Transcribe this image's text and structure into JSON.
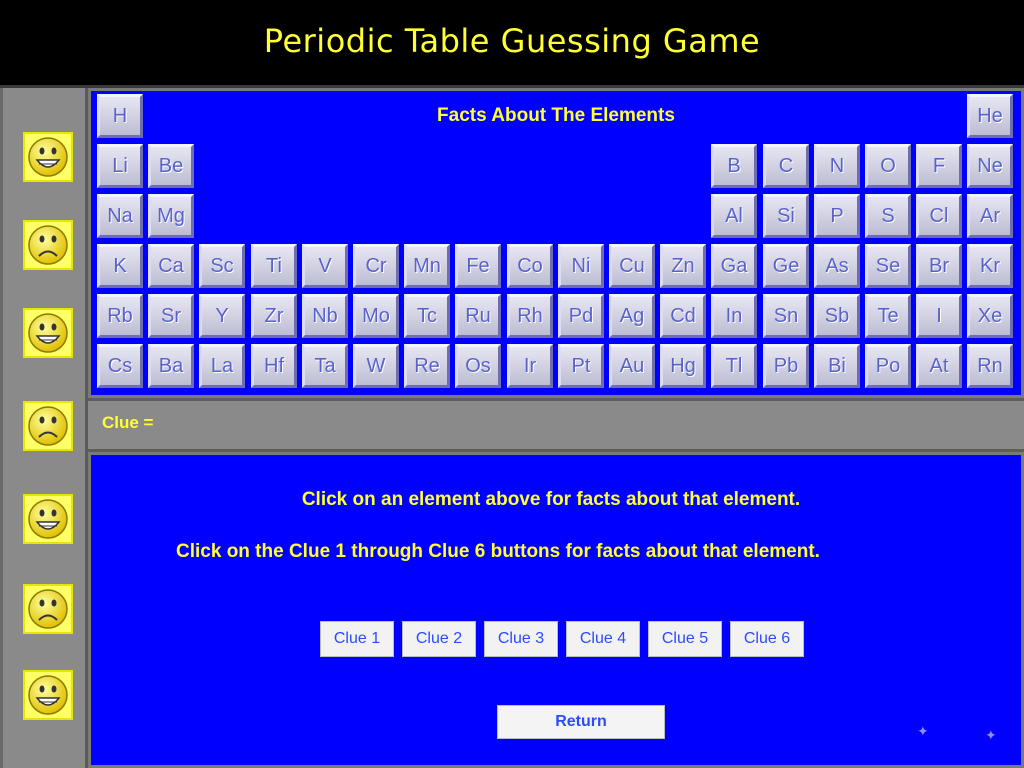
{
  "header": {
    "title": "Periodic Table Guessing Game"
  },
  "table": {
    "title": "Facts About The Elements",
    "rows": [
      [
        "H",
        "",
        "",
        "",
        "",
        "",
        "",
        "",
        "",
        "",
        "",
        "",
        "",
        "",
        "",
        "",
        "",
        "He"
      ],
      [
        "Li",
        "Be",
        "",
        "",
        "",
        "",
        "",
        "",
        "",
        "",
        "",
        "",
        "B",
        "C",
        "N",
        "O",
        "F",
        "Ne"
      ],
      [
        "Na",
        "Mg",
        "",
        "",
        "",
        "",
        "",
        "",
        "",
        "",
        "",
        "",
        "Al",
        "Si",
        "P",
        "S",
        "Cl",
        "Ar"
      ],
      [
        "K",
        "Ca",
        "Sc",
        "Ti",
        "V",
        "Cr",
        "Mn",
        "Fe",
        "Co",
        "Ni",
        "Cu",
        "Zn",
        "Ga",
        "Ge",
        "As",
        "Se",
        "Br",
        "Kr"
      ],
      [
        "Rb",
        "Sr",
        "Y",
        "Zr",
        "Nb",
        "Mo",
        "Tc",
        "Ru",
        "Rh",
        "Pd",
        "Ag",
        "Cd",
        "In",
        "Sn",
        "Sb",
        "Te",
        "I",
        "Xe"
      ],
      [
        "Cs",
        "Ba",
        "La",
        "Hf",
        "Ta",
        "W",
        "Re",
        "Os",
        "Ir",
        "Pt",
        "Au",
        "Hg",
        "Tl",
        "Pb",
        "Bi",
        "Po",
        "At",
        "Rn"
      ]
    ]
  },
  "clue_bar": {
    "label": "Clue ="
  },
  "info": {
    "line1": "Click on an element above for facts about that element.",
    "line2": "Click on the Clue 1 through Clue 6 buttons for facts about that element.",
    "clue_buttons": [
      "Clue 1",
      "Clue 2",
      "Clue 3",
      "Clue 4",
      "Clue 5",
      "Clue 6"
    ],
    "return_label": "Return"
  },
  "sidebar": {
    "faces": [
      "happy",
      "sad",
      "happy",
      "sad",
      "happy",
      "sad",
      "happy"
    ]
  },
  "colors": {
    "background_blue": "#0000ff",
    "accent_yellow": "#ffff33",
    "element_text": "#5a62cc"
  }
}
